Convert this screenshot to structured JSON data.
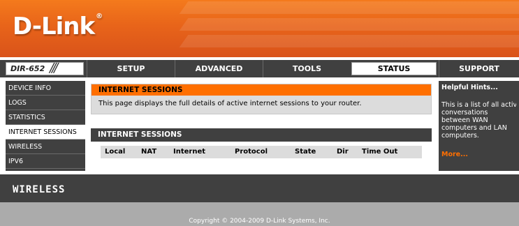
{
  "header": {
    "logo_text": "D-Link",
    "logo_mark": "®"
  },
  "nav": {
    "model": "DIR-652",
    "tabs": [
      {
        "label": "SETUP"
      },
      {
        "label": "ADVANCED"
      },
      {
        "label": "TOOLS"
      },
      {
        "label": "STATUS",
        "active": true
      },
      {
        "label": "SUPPORT"
      }
    ]
  },
  "sidebar": {
    "items": [
      {
        "label": "DEVICE INFO"
      },
      {
        "label": "LOGS"
      },
      {
        "label": "STATISTICS"
      },
      {
        "label": "INTERNET SESSIONS",
        "active": true
      },
      {
        "label": "WIRELESS"
      },
      {
        "label": "IPV6"
      }
    ]
  },
  "main": {
    "section1": {
      "title": "INTERNET SESSIONS",
      "description": "This page displays the full details of active internet sessions to your router."
    },
    "section2": {
      "title": "INTERNET SESSIONS",
      "columns": [
        "Local",
        "NAT",
        "Internet",
        "Protocol",
        "State",
        "Dir",
        "Time Out"
      ]
    }
  },
  "hints": {
    "title": "Helpful Hints...",
    "lines": [
      "This is a list of all active",
      "conversations",
      "between WAN",
      "computers and LAN",
      "computers."
    ],
    "more": "More..."
  },
  "footer": {
    "brand": "WIRELESS",
    "copyright": "Copyright © 2004-2009 D-Link Systems, Inc."
  },
  "colors": {
    "brand_orange": "#ff6f00",
    "dark_gray": "#404040",
    "panel_gray": "#dcdcdc"
  }
}
